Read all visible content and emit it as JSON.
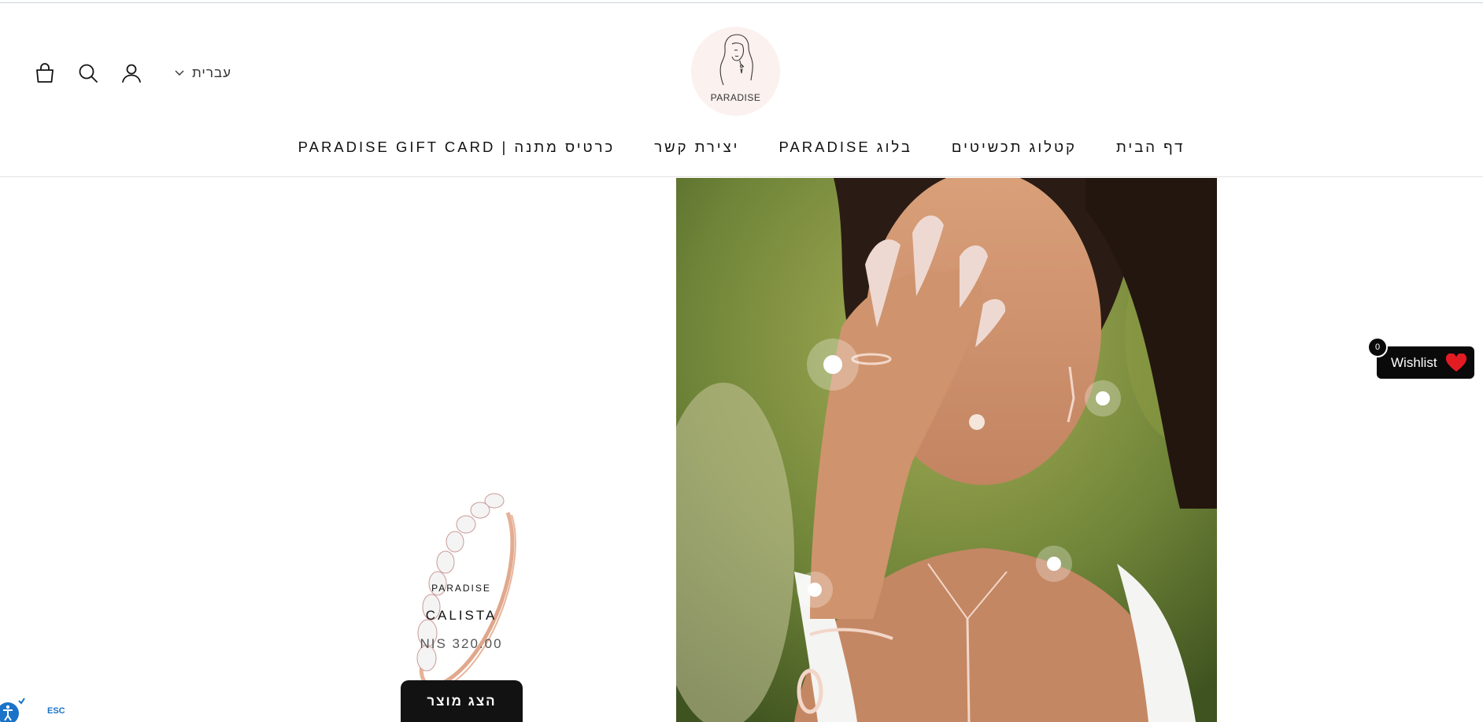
{
  "header": {
    "language": "עברית",
    "logo_text": "PARADISE",
    "icons": [
      "cart-icon",
      "search-icon",
      "account-icon",
      "chevron-down-icon"
    ]
  },
  "nav": {
    "items": [
      "דף הבית",
      "קטלוג תכשיטים",
      "בלוג PARADISE",
      "יצירת קשר",
      "כרטיס מתנה | PARADISE GIFT CARD"
    ]
  },
  "product": {
    "vendor": "PARADISE",
    "title": "CALISTA",
    "price": "NIS 320.00",
    "button_label": "הצג מוצר"
  },
  "wishlist": {
    "label": "Wishlist",
    "count": "0",
    "heart_color": "#e31b23"
  },
  "accessibility": {
    "esc_label": "ESC"
  }
}
